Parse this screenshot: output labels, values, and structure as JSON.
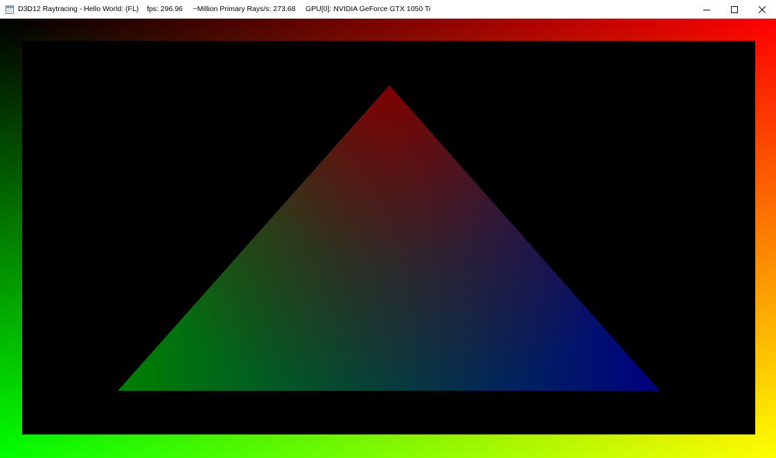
{
  "window": {
    "title": "D3D12 Raytracing - Hello World: (FL)    fps: 296.96     ~Million Primary Rays/s: 273.68     GPU[0]: NVIDIA GeForce GTX 1050 Ti",
    "app_icon": "window-app-icon",
    "controls": {
      "minimize_icon": "minimize-icon",
      "maximize_icon": "maximize-icon",
      "close_icon": "close-icon"
    }
  },
  "scene": {
    "background_color": "#000000",
    "corner_colors": {
      "top_left": "#000000",
      "top_right": "#ff0000",
      "bottom_left": "#00ff00",
      "bottom_right": "#ffff00"
    },
    "triangle_vertex_colors": {
      "top": "#800000",
      "bottom_left": "#008000",
      "bottom_right": "#000080"
    }
  }
}
